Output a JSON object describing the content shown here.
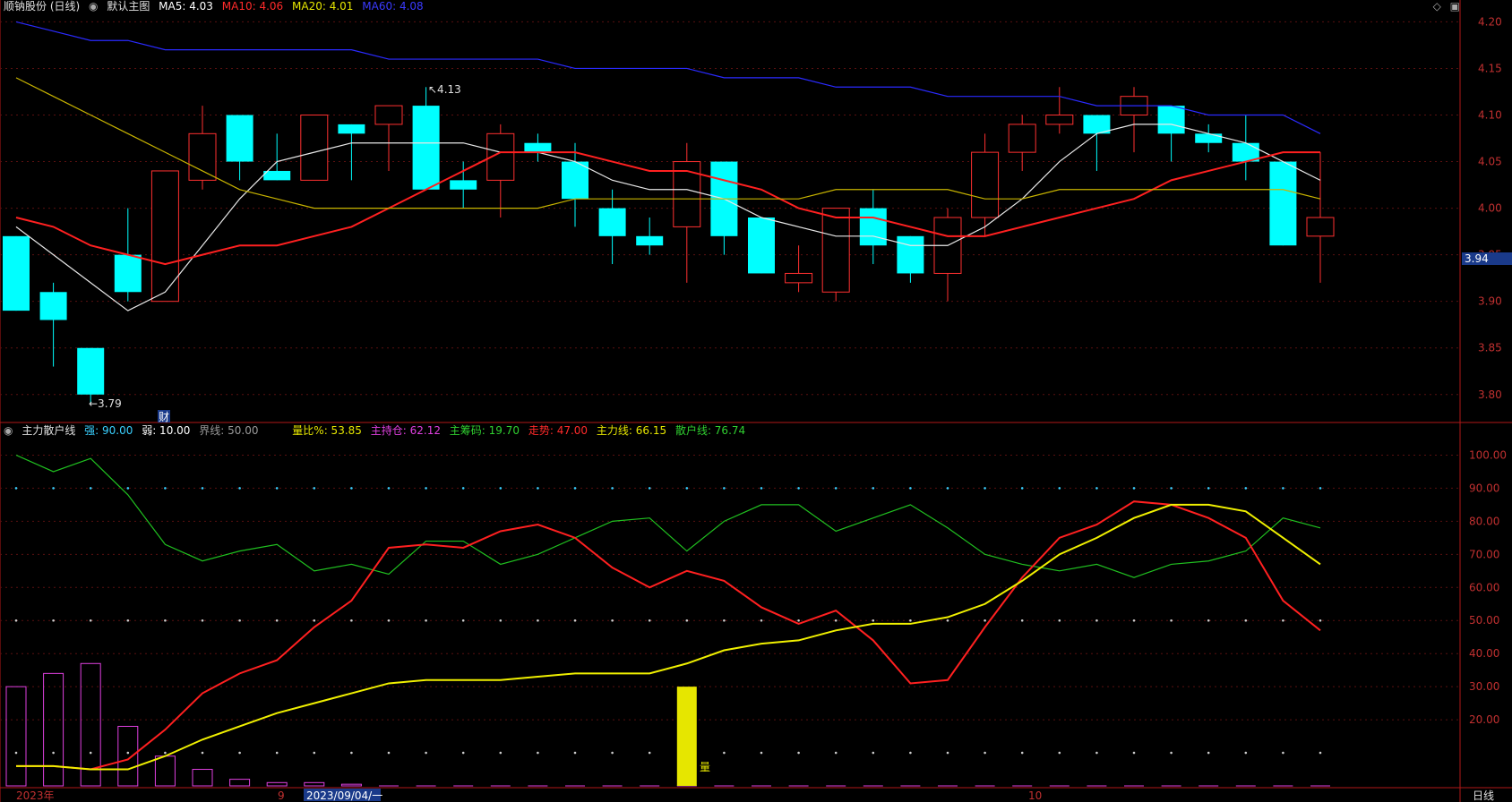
{
  "title": {
    "stock": "顺钠股份 (日线)",
    "main_label": "默认主图",
    "ma": [
      {
        "label": "MA5: 4.03",
        "color": "#ffffff"
      },
      {
        "label": "MA10: 4.06",
        "color": "#ff2a2a"
      },
      {
        "label": "MA20: 4.01",
        "color": "#e6e600"
      },
      {
        "label": "MA60: 4.08",
        "color": "#3a3aff"
      }
    ]
  },
  "indicator": {
    "name": "主力散户线",
    "params": [
      {
        "label": "强: 90.00",
        "color": "#3ad0ff"
      },
      {
        "label": "弱: 10.00",
        "color": "#ffffff"
      },
      {
        "label": "界线: 50.00",
        "color": "#9a9a9a"
      }
    ],
    "values": [
      {
        "label": "量比%: 53.85",
        "color": "#e6e600"
      },
      {
        "label": "主持仓: 62.12",
        "color": "#e040e0"
      },
      {
        "label": "主筹码: 19.70",
        "color": "#30d030"
      },
      {
        "label": "走势: 47.00",
        "color": "#ff2a2a"
      },
      {
        "label": "主力线: 66.15",
        "color": "#e6e600"
      },
      {
        "label": "散户线: 76.74",
        "color": "#30d030"
      }
    ]
  },
  "icons": {
    "diamond": "diamond-icon",
    "window": "window-icon"
  },
  "price_tag": "3.94",
  "period_label": "日线",
  "date_labels": {
    "year": "2023年",
    "sep": "9",
    "oct": "10",
    "cursor": "2023/09/04/一"
  },
  "annotations": {
    "high": "4.13",
    "low": "3.79",
    "cai": "财",
    "liang": "量"
  },
  "chart_data": [
    {
      "type": "candlestick",
      "ylim": [
        3.77,
        4.21
      ],
      "ytick_labels": [
        "4.20",
        "4.15",
        "4.10",
        "4.05",
        "4.00",
        "3.95",
        "3.90",
        "3.85",
        "3.80"
      ],
      "yticks": [
        4.2,
        4.15,
        4.1,
        4.05,
        4.0,
        3.95,
        3.9,
        3.85,
        3.8
      ],
      "candles": [
        {
          "o": 3.97,
          "c": 3.89,
          "h": 3.97,
          "l": 3.89
        },
        {
          "o": 3.91,
          "c": 3.88,
          "h": 3.92,
          "l": 3.83
        },
        {
          "o": 3.85,
          "c": 3.8,
          "h": 3.85,
          "l": 3.79
        },
        {
          "o": 3.95,
          "c": 3.91,
          "h": 4.0,
          "l": 3.9
        },
        {
          "o": 3.9,
          "c": 4.04,
          "h": 4.04,
          "l": 3.9
        },
        {
          "o": 4.03,
          "c": 4.08,
          "h": 4.11,
          "l": 4.02
        },
        {
          "o": 4.1,
          "c": 4.05,
          "h": 4.1,
          "l": 4.03
        },
        {
          "o": 4.04,
          "c": 4.03,
          "h": 4.08,
          "l": 4.03
        },
        {
          "o": 4.03,
          "c": 4.1,
          "h": 4.1,
          "l": 4.03
        },
        {
          "o": 4.09,
          "c": 4.08,
          "h": 4.09,
          "l": 4.03
        },
        {
          "o": 4.09,
          "c": 4.11,
          "h": 4.11,
          "l": 4.04
        },
        {
          "o": 4.11,
          "c": 4.02,
          "h": 4.13,
          "l": 4.02
        },
        {
          "o": 4.03,
          "c": 4.02,
          "h": 4.05,
          "l": 4.0
        },
        {
          "o": 4.03,
          "c": 4.08,
          "h": 4.09,
          "l": 3.99
        },
        {
          "o": 4.07,
          "c": 4.06,
          "h": 4.08,
          "l": 4.05
        },
        {
          "o": 4.05,
          "c": 4.01,
          "h": 4.07,
          "l": 3.98
        },
        {
          "o": 4.0,
          "c": 3.97,
          "h": 4.02,
          "l": 3.94
        },
        {
          "o": 3.97,
          "c": 3.96,
          "h": 3.99,
          "l": 3.95
        },
        {
          "o": 3.98,
          "c": 4.05,
          "h": 4.07,
          "l": 3.92
        },
        {
          "o": 4.05,
          "c": 3.97,
          "h": 4.05,
          "l": 3.95
        },
        {
          "o": 3.99,
          "c": 3.93,
          "h": 3.99,
          "l": 3.93
        },
        {
          "o": 3.92,
          "c": 3.93,
          "h": 3.96,
          "l": 3.91
        },
        {
          "o": 3.91,
          "c": 4.0,
          "h": 4.0,
          "l": 3.9
        },
        {
          "o": 4.0,
          "c": 3.96,
          "h": 4.02,
          "l": 3.94
        },
        {
          "o": 3.97,
          "c": 3.93,
          "h": 3.97,
          "l": 3.92
        },
        {
          "o": 3.93,
          "c": 3.99,
          "h": 4.0,
          "l": 3.9
        },
        {
          "o": 3.99,
          "c": 4.06,
          "h": 4.08,
          "l": 3.97
        },
        {
          "o": 4.06,
          "c": 4.09,
          "h": 4.1,
          "l": 4.04
        },
        {
          "o": 4.09,
          "c": 4.1,
          "h": 4.13,
          "l": 4.08
        },
        {
          "o": 4.1,
          "c": 4.08,
          "h": 4.1,
          "l": 4.04
        },
        {
          "o": 4.1,
          "c": 4.12,
          "h": 4.13,
          "l": 4.06
        },
        {
          "o": 4.11,
          "c": 4.08,
          "h": 4.11,
          "l": 4.05
        },
        {
          "o": 4.08,
          "c": 4.07,
          "h": 4.09,
          "l": 4.06
        },
        {
          "o": 4.07,
          "c": 4.05,
          "h": 4.1,
          "l": 4.03
        },
        {
          "o": 4.05,
          "c": 3.96,
          "h": 4.05,
          "l": 3.96
        },
        {
          "o": 3.97,
          "c": 3.99,
          "h": 4.06,
          "l": 3.92
        }
      ],
      "series": [
        {
          "name": "MA5",
          "color": "#e8e8e8",
          "values": [
            3.98,
            3.95,
            3.92,
            3.89,
            3.91,
            3.96,
            4.01,
            4.05,
            4.06,
            4.07,
            4.07,
            4.07,
            4.07,
            4.06,
            4.06,
            4.05,
            4.03,
            4.02,
            4.02,
            4.01,
            3.99,
            3.98,
            3.97,
            3.97,
            3.96,
            3.96,
            3.98,
            4.01,
            4.05,
            4.08,
            4.09,
            4.09,
            4.08,
            4.07,
            4.05,
            4.03
          ]
        },
        {
          "name": "MA10",
          "color": "#ff2020",
          "values": [
            3.99,
            3.98,
            3.96,
            3.95,
            3.94,
            3.95,
            3.96,
            3.96,
            3.97,
            3.98,
            4.0,
            4.02,
            4.04,
            4.06,
            4.06,
            4.06,
            4.05,
            4.04,
            4.04,
            4.03,
            4.02,
            4.0,
            3.99,
            3.99,
            3.98,
            3.97,
            3.97,
            3.98,
            3.99,
            4.0,
            4.01,
            4.03,
            4.04,
            4.05,
            4.06,
            4.06
          ]
        },
        {
          "name": "MA20",
          "color": "#c8b400",
          "values": [
            4.14,
            4.12,
            4.1,
            4.08,
            4.06,
            4.04,
            4.02,
            4.01,
            4.0,
            4.0,
            4.0,
            4.0,
            4.0,
            4.0,
            4.0,
            4.01,
            4.01,
            4.01,
            4.01,
            4.01,
            4.01,
            4.01,
            4.02,
            4.02,
            4.02,
            4.02,
            4.01,
            4.01,
            4.02,
            4.02,
            4.02,
            4.02,
            4.02,
            4.02,
            4.02,
            4.01
          ]
        },
        {
          "name": "MA60",
          "color": "#2a2aff",
          "values": [
            4.2,
            4.19,
            4.18,
            4.18,
            4.17,
            4.17,
            4.17,
            4.17,
            4.17,
            4.17,
            4.16,
            4.16,
            4.16,
            4.16,
            4.16,
            4.15,
            4.15,
            4.15,
            4.15,
            4.14,
            4.14,
            4.14,
            4.13,
            4.13,
            4.13,
            4.12,
            4.12,
            4.12,
            4.12,
            4.11,
            4.11,
            4.11,
            4.1,
            4.1,
            4.1,
            4.08
          ]
        }
      ]
    },
    {
      "type": "line",
      "ylim": [
        0,
        105
      ],
      "yticks": [
        100,
        90,
        80,
        70,
        60,
        50,
        40,
        30,
        20
      ],
      "ytick_labels": [
        "100.00",
        "90.00",
        "80.00",
        "70.00",
        "60.00",
        "50.00",
        "40.00",
        "30.00",
        "20.00"
      ],
      "series": [
        {
          "name": "散户线",
          "color": "#20c020",
          "values": [
            100,
            95,
            99,
            88,
            73,
            68,
            71,
            73,
            65,
            67,
            64,
            74,
            74,
            67,
            70,
            75,
            80,
            81,
            71,
            80,
            85,
            85,
            77,
            81,
            85,
            78,
            70,
            67,
            65,
            67,
            63,
            67,
            68,
            71,
            81,
            78
          ]
        },
        {
          "name": "走势",
          "color": "#ff2020",
          "values": [
            6,
            6,
            5,
            8,
            17,
            28,
            34,
            38,
            48,
            56,
            72,
            73,
            72,
            77,
            79,
            75,
            66,
            60,
            65,
            62,
            54,
            49,
            53,
            44,
            31,
            32,
            48,
            63,
            75,
            79,
            86,
            85,
            81,
            75,
            56,
            47
          ]
        },
        {
          "name": "主力线",
          "color": "#f0f000",
          "values": [
            6,
            6,
            5,
            5,
            9,
            14,
            18,
            22,
            25,
            28,
            31,
            32,
            32,
            32,
            33,
            34,
            34,
            34,
            37,
            41,
            43,
            44,
            47,
            49,
            49,
            51,
            55,
            62,
            70,
            75,
            81,
            85,
            85,
            83,
            75,
            67
          ]
        }
      ],
      "bars": {
        "color": "#e040e0",
        "values": [
          30,
          34,
          37,
          18,
          9,
          5,
          2,
          1,
          1,
          0.5,
          0,
          0,
          0,
          0,
          0,
          0,
          0,
          0,
          0,
          0,
          0,
          0,
          0,
          0,
          0,
          0,
          0,
          0,
          0,
          0,
          0,
          0,
          0,
          0,
          0,
          0
        ]
      },
      "volume_marker": {
        "index": 18,
        "value": 30,
        "color": "#e6e600"
      }
    }
  ]
}
